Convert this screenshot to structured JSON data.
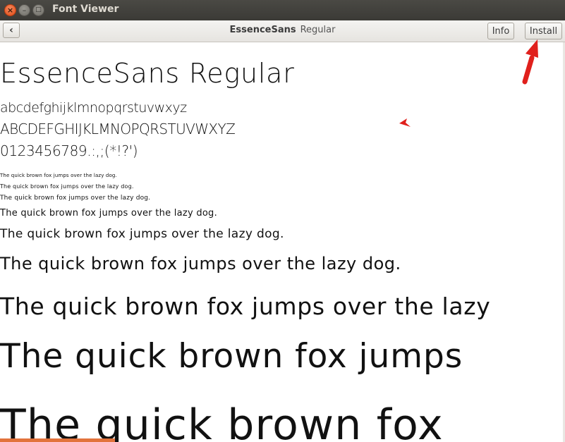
{
  "window": {
    "title": "Font Viewer",
    "close_glyph": "×",
    "minimize_glyph": "–",
    "maximize_glyph": "□"
  },
  "header": {
    "back_glyph": "‹",
    "font_family": "EssenceSans",
    "font_style": "Regular",
    "info_label": "Info",
    "install_label": "Install"
  },
  "content": {
    "font_name": "EssenceSans Regular",
    "lowercase": "abcdefghijklmnopqrstuvwxyz",
    "uppercase": "ABCDEFGHIJKLMNOPQRSTUVWXYZ",
    "digits": "0123456789.:,;(*!?')",
    "samples": [
      "The quick brown fox jumps over the lazy dog.",
      "The quick brown fox jumps over the lazy dog.",
      "The quick brown fox jumps over the lazy dog.",
      "The quick brown fox jumps over the lazy dog.",
      "The quick brown fox jumps over the lazy dog.",
      "The quick brown fox jumps over the lazy dog.",
      "The quick brown fox jumps over the lazy",
      "The quick brown fox jumps",
      "The quick brown fox"
    ]
  },
  "annotations": {
    "arrow_color": "#e0201c"
  }
}
